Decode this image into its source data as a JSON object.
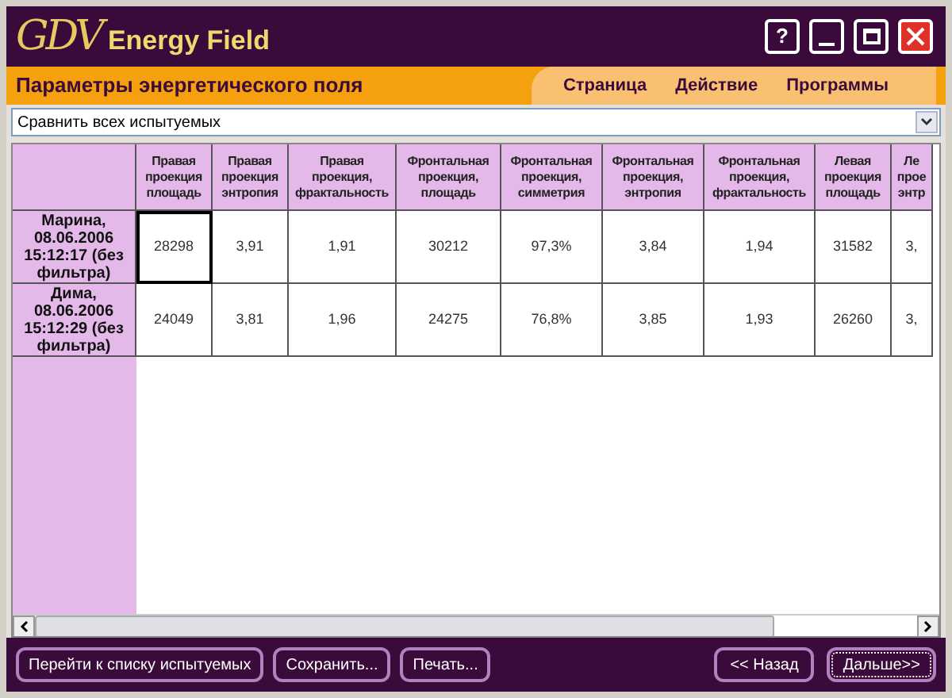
{
  "window": {
    "logo_mark": "GDV",
    "logo_text": "Energy Field",
    "controls": [
      {
        "kind": "help",
        "label": "?"
      },
      {
        "kind": "minimize"
      },
      {
        "kind": "maximize"
      },
      {
        "kind": "close"
      }
    ]
  },
  "header": {
    "title": "Параметры энергетического поля",
    "menu": [
      "Страница",
      "Действие",
      "Программы"
    ]
  },
  "selector": {
    "value": "Сравнить всех испытуемых"
  },
  "table": {
    "columns": [
      "Правая проекция площадь",
      "Правая проекция энтропия",
      "Правая проекция, фрактальность",
      "Фронтальная проекция, площадь",
      "Фронтальная проекция, симметрия",
      "Фронтальная проекция, энтропия",
      "Фронтальная проекция, фрактальность",
      "Левая проекция площадь",
      "Ле прое энтр"
    ],
    "rows": [
      {
        "label": "Марина, 08.06.2006 15:12:17 (без фильтра)",
        "cells": [
          {
            "text": "28298",
            "selected": true
          },
          {
            "text": "3,91",
            "selected": false
          },
          {
            "text": "1,91",
            "selected": false
          },
          {
            "text": "30212",
            "selected": false
          },
          {
            "text": "97,3%",
            "selected": false
          },
          {
            "text": "3,84",
            "selected": false
          },
          {
            "text": "1,94",
            "selected": false
          },
          {
            "text": "31582",
            "selected": false
          },
          {
            "text": "3,",
            "selected": false
          }
        ]
      },
      {
        "label": "Дима, 08.06.2006 15:12:29 (без фильтра)",
        "cells": [
          {
            "text": "24049",
            "selected": false
          },
          {
            "text": "3,81",
            "selected": false
          },
          {
            "text": "1,96",
            "selected": false
          },
          {
            "text": "24275",
            "selected": false
          },
          {
            "text": "76,8%",
            "selected": false
          },
          {
            "text": "3,85",
            "selected": false
          },
          {
            "text": "1,93",
            "selected": false
          },
          {
            "text": "26260",
            "selected": false
          },
          {
            "text": "3,",
            "selected": false
          }
        ]
      }
    ]
  },
  "footer": {
    "left_buttons": [
      "Перейти к списку испытуемых",
      "Сохранить...",
      "Печать..."
    ],
    "right_buttons": [
      {
        "label": "<< Назад",
        "selected": false
      },
      {
        "label": "Дальше>>",
        "selected": true
      }
    ]
  }
}
